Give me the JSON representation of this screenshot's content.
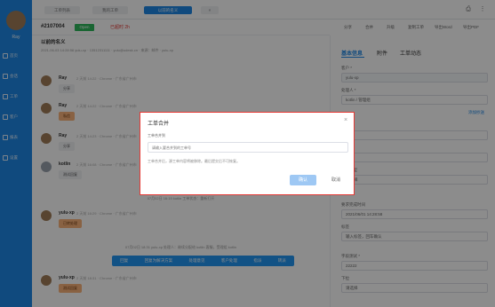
{
  "sidebar": {
    "user_name": "Ray",
    "items": [
      {
        "label": "首页",
        "icon": "home-icon"
      },
      {
        "label": "会话",
        "icon": "chat-icon"
      },
      {
        "label": "工单",
        "icon": "ticket-icon"
      },
      {
        "label": "客户",
        "icon": "customer-icon"
      },
      {
        "label": "报表",
        "icon": "chart-icon"
      },
      {
        "label": "设置",
        "icon": "gear-icon"
      }
    ]
  },
  "topbar": {
    "tabs": [
      "工单列表",
      "我的工单",
      "以前的名义",
      "×"
    ],
    "printer_icon": "printer-icon",
    "more_icon": "more-icon"
  },
  "ticket": {
    "number": "#2107004",
    "status": "Open",
    "sla": "已超时 2h"
  },
  "toolbar_right": {
    "actions": [
      "分享",
      "合并",
      "升级",
      "复制工单",
      "导出Word",
      "导出PDF"
    ]
  },
  "conversation": {
    "subject": "以前的名义",
    "meta": "2021-06-03 14:28:58 yulu-xp · 13512311111 · yulu@udesk.cn · 来源：邮件 · yulu-xp",
    "messages": [
      {
        "who": "Ray",
        "info": "2 天前 14:22 · Chrome · 广东省广州市",
        "text": "分享",
        "orange": false,
        "gray_avatar": false
      },
      {
        "who": "Ray",
        "info": "2 天前 14:22 · Chrome · 广东省广州市",
        "text": "私信",
        "orange": true,
        "gray_avatar": false
      },
      {
        "who": "Ray",
        "info": "2 天前 14:23 · Chrome · 广东省广州市",
        "text": "分享",
        "orange": false,
        "gray_avatar": false
      },
      {
        "who": "kotlin",
        "info": "2 天前 16:08 · Chrome · 广东省广州市",
        "text": "测试回复",
        "orange": false,
        "gray_avatar": true
      },
      {
        "who": "yulu-xp",
        "info": "2 天前 16:29 · Chrome · 广东省广州市",
        "text": "已转处理",
        "orange": true,
        "gray_avatar": false
      },
      {
        "who": "yulu-xp",
        "info": "2 天前 18:31 · Chrome · 广东省广州市",
        "text": "测试回复",
        "orange": true,
        "gray_avatar": false
      }
    ],
    "system_lines": [
      "07月02日 16:19 kotlin 工单状态：重新打开",
      "07月02日 18:31 yulu-xp 处理人：继续分配给 kotlin 客服，受理组 kotlin"
    ],
    "quick_actions": [
      "回复",
      "回复为解决方案",
      "处理意见",
      "客户处理",
      "指派",
      "转派"
    ]
  },
  "right_panel": {
    "tabs": [
      "基本信息",
      "附件",
      "工单动态"
    ],
    "fields": [
      {
        "label": "客户 *",
        "value": "yulu-xp"
      },
      {
        "label": "处理人 *",
        "value": "kotlin / 管理组"
      },
      {
        "label": "优先级",
        "value": "标准"
      },
      {
        "label": "状态",
        "value": "开启"
      },
      {
        "label": "工单类型",
        "value": "请选择"
      },
      {
        "label": "要求完成时间",
        "value": "2021/06/01 14:28:58"
      },
      {
        "label": "标签",
        "value": "输入标签，回车确认"
      },
      {
        "label": "字段测试 *",
        "value": "22222"
      },
      {
        "label": "下拉",
        "value": "请选择"
      }
    ],
    "link": "添加抄送"
  },
  "dialog": {
    "title": "工单合并",
    "close": "×",
    "label": "工单合并到",
    "placeholder": "请输入要合并到的工单号",
    "note": "工单合并后，源工单内容将被移除。最后提交后不可恢复。",
    "ok": "确认",
    "cancel": "取消"
  }
}
